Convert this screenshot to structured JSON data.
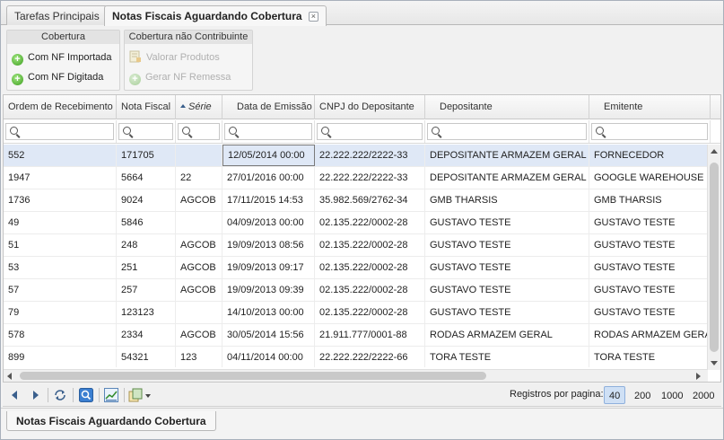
{
  "tabs": [
    {
      "label": "Tarefas Principais",
      "active": false
    },
    {
      "label": "Notas Fiscais Aguardando Cobertura",
      "active": true,
      "closable": true
    }
  ],
  "ribbon": {
    "group1": {
      "title": "Cobertura",
      "items": [
        "Com NF Importada",
        "Com NF Digitada"
      ]
    },
    "group2": {
      "title": "Cobertura não Contribuinte",
      "items": [
        "Valorar Produtos",
        "Gerar NF Remessa"
      ]
    }
  },
  "columns": [
    {
      "label": "Ordem de Recebimento"
    },
    {
      "label": "Nota Fiscal"
    },
    {
      "label": "Série",
      "sorted": "asc"
    },
    {
      "label": "Data de Emissão"
    },
    {
      "label": "CNPJ do Depositante"
    },
    {
      "label": "Depositante"
    },
    {
      "label": "Emitente"
    }
  ],
  "rows": [
    [
      "552",
      "171705",
      "",
      "12/05/2014 00:00",
      "22.222.222/2222-33",
      "DEPOSITANTE ARMAZEM GERAL",
      "FORNECEDOR"
    ],
    [
      "1947",
      "5664",
      "22",
      "27/01/2016 00:00",
      "22.222.222/2222-33",
      "DEPOSITANTE ARMAZEM GERAL",
      "GOOGLE WAREHOUSE"
    ],
    [
      "1736",
      "9024",
      "AGCOB",
      "17/11/2015 14:53",
      "35.982.569/2762-34",
      "GMB THARSIS",
      "GMB THARSIS"
    ],
    [
      "49",
      "5846",
      "",
      "04/09/2013 00:00",
      "02.135.222/0002-28",
      "GUSTAVO TESTE",
      "GUSTAVO TESTE"
    ],
    [
      "51",
      "248",
      "AGCOB",
      "19/09/2013 08:56",
      "02.135.222/0002-28",
      "GUSTAVO TESTE",
      "GUSTAVO TESTE"
    ],
    [
      "53",
      "251",
      "AGCOB",
      "19/09/2013 09:17",
      "02.135.222/0002-28",
      "GUSTAVO TESTE",
      "GUSTAVO TESTE"
    ],
    [
      "57",
      "257",
      "AGCOB",
      "19/09/2013 09:39",
      "02.135.222/0002-28",
      "GUSTAVO TESTE",
      "GUSTAVO TESTE"
    ],
    [
      "79",
      "123123",
      "",
      "14/10/2013 00:00",
      "02.135.222/0002-28",
      "GUSTAVO TESTE",
      "GUSTAVO TESTE"
    ],
    [
      "578",
      "2334",
      "AGCOB",
      "30/05/2014 15:56",
      "21.911.777/0001-88",
      "RODAS ARMAZEM GERAL",
      "RODAS ARMAZEM GERAL"
    ],
    [
      "899",
      "54321",
      "123",
      "04/11/2014 00:00",
      "22.222.222/2222-66",
      "TORA TESTE",
      "TORA TESTE"
    ]
  ],
  "pager": {
    "label": "Registros por pagina:",
    "options": [
      "40",
      "200",
      "1000",
      "2000"
    ],
    "selected": "40"
  },
  "bottom_tab": {
    "label": "Notas Fiscais Aguardando Cobertura"
  }
}
